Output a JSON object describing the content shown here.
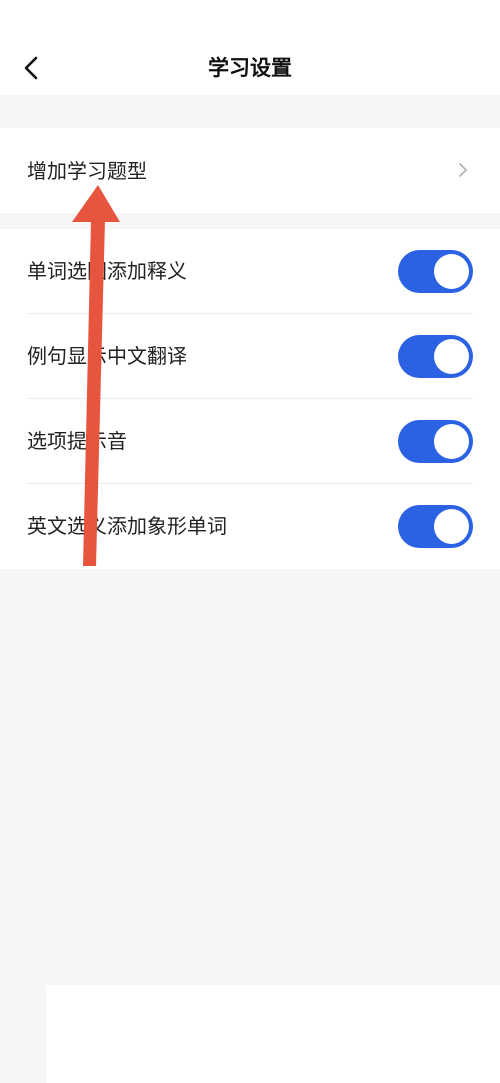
{
  "header": {
    "title": "学习设置",
    "back_icon": "chevron-left-icon"
  },
  "section_add": {
    "label": "增加学习题型",
    "chevron_icon": "chevron-right-icon"
  },
  "settings": [
    {
      "label": "单词选图添加释义",
      "enabled": true
    },
    {
      "label": "例句显示中文翻译",
      "enabled": true
    },
    {
      "label": "选项提示音",
      "enabled": true
    },
    {
      "label": "英文选义添加象形单词",
      "enabled": true
    }
  ],
  "colors": {
    "toggle_on": "#2b61e3",
    "annotation_arrow": "#e8553f",
    "background": "#f6f6f6"
  }
}
